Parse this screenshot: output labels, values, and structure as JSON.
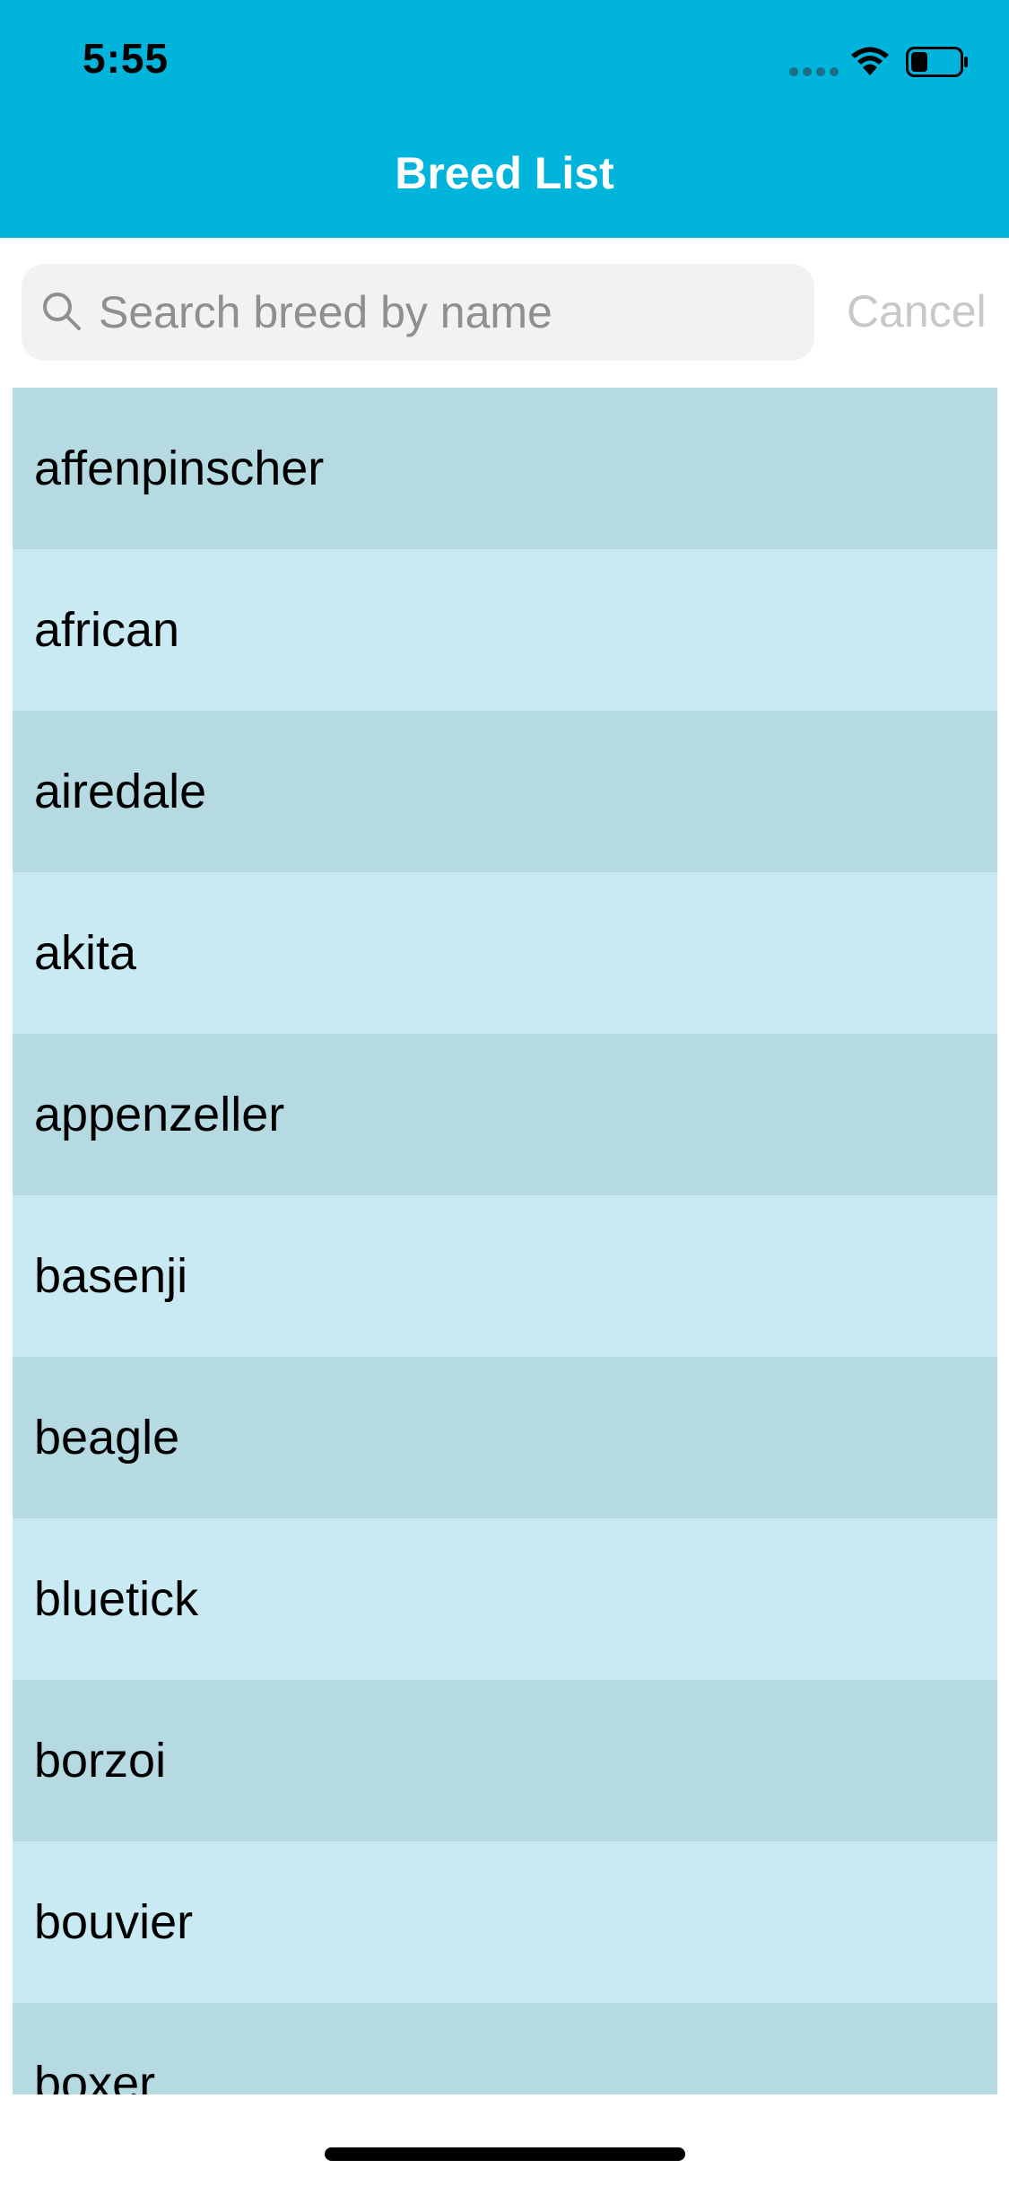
{
  "status_bar": {
    "time": "5:55",
    "icons": [
      "cellular-signal-icon",
      "wifi-icon",
      "battery-icon"
    ],
    "battery_level": 0.35
  },
  "nav": {
    "title": "Breed List"
  },
  "search": {
    "placeholder": "Search breed by name",
    "value": "",
    "cancel_label": "Cancel"
  },
  "breeds": [
    "affenpinscher",
    "african",
    "airedale",
    "akita",
    "appenzeller",
    "basenji",
    "beagle",
    "bluetick",
    "borzoi",
    "bouvier",
    "boxer"
  ],
  "colors": {
    "header": "#00b4dc",
    "row_dark": "#b5dae2",
    "row_light": "#c9eaf2",
    "search_bg": "#f2f2f2",
    "cancel_text": "#c7c7cc"
  }
}
